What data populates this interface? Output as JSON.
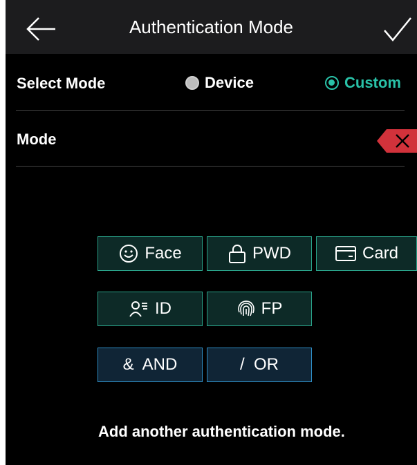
{
  "header": {
    "title": "Authentication Mode",
    "back_icon": "arrow-left-icon",
    "confirm_icon": "check-icon"
  },
  "select_mode": {
    "label": "Select Mode",
    "options": [
      {
        "label": "Device",
        "selected": false
      },
      {
        "label": "Custom",
        "selected": true
      }
    ]
  },
  "mode": {
    "label": "Mode",
    "value": "",
    "delete_icon": "backspace-icon"
  },
  "auth_buttons": [
    {
      "label": "Face",
      "icon": "smiley-face-icon"
    },
    {
      "label": "PWD",
      "icon": "lock-icon"
    },
    {
      "label": "Card",
      "icon": "card-icon"
    },
    {
      "label": "ID",
      "icon": "person-id-icon"
    },
    {
      "label": "FP",
      "icon": "fingerprint-icon"
    }
  ],
  "logic_buttons": [
    {
      "label": "&  AND"
    },
    {
      "label": "/  OR"
    }
  ],
  "hint": "Add another authentication mode.",
  "colors": {
    "accent": "#29c2a8",
    "button_border": "#2aa38a",
    "logic_border": "#2f8fc7",
    "delete": "#d1323b",
    "background": "#000000",
    "header": "#1c1c1e"
  }
}
